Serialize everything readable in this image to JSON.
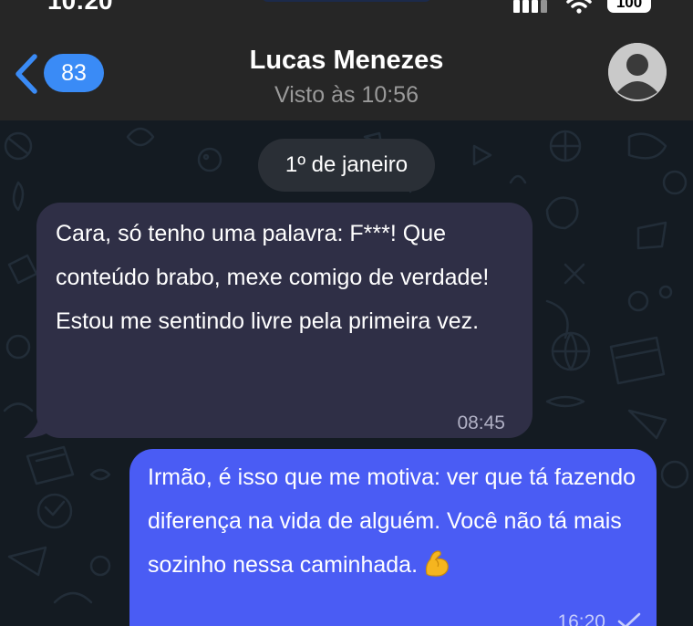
{
  "status_bar": {
    "time": "10:20",
    "battery": "100",
    "icons": [
      "signal-icon",
      "wifi-icon",
      "battery-icon"
    ]
  },
  "header": {
    "back_badge": "83",
    "contact_name": "Lucas Menezes",
    "last_seen": "Visto às 10:56",
    "icons": [
      "back-chevron-icon",
      "avatar-placeholder-icon"
    ]
  },
  "chat": {
    "date_label": "1º de janeiro",
    "messages": [
      {
        "direction": "incoming",
        "text": "Cara, só tenho uma palavra: F***! Que conteúdo brabo, mexe comigo de verdade! Estou me sentindo livre pela primeira vez.",
        "time": "08:45"
      },
      {
        "direction": "outgoing",
        "text": "Irmão, é isso que me motiva: ver que tá fazendo diferença na vida de alguém. Você não tá mais sozinho nessa caminhada.",
        "emoji": "flexed-biceps-icon",
        "time": "16:20",
        "status_icon": "read-check-icon"
      }
    ]
  },
  "colors": {
    "header_bg": "#262626",
    "wallpaper_bg": "#141b22",
    "incoming_bubble": "#2f2f46",
    "outgoing_bubble": "#4a5cf4",
    "accent_blue": "#3a8bf6",
    "date_pill": "#2a2f36"
  }
}
